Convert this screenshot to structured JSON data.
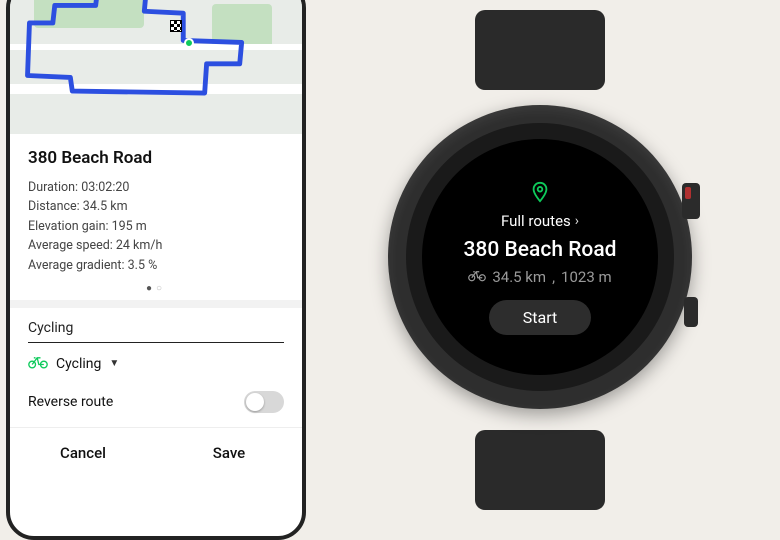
{
  "phone": {
    "route_title": "380 Beach Road",
    "stats": {
      "duration_label": "Duration:",
      "duration_value": "03:02:20",
      "distance_label": "Distance:",
      "distance_value": "34.5 km",
      "elev_label": "Elevation gain:",
      "elev_value": "195 m",
      "speed_label": "Average speed:",
      "speed_value": "24 km/h",
      "grad_label": "Average gradient:",
      "grad_value": "3.5 %"
    },
    "activity_section_label": "Cycling",
    "activity_selected": "Cycling",
    "reverse_label": "Reverse route",
    "reverse_on": false,
    "cancel_label": "Cancel",
    "save_label": "Save"
  },
  "watch": {
    "full_routes_label": "Full routes",
    "route_title": "380 Beach Road",
    "distance": "34.5 km",
    "elevation": "1023 m",
    "start_label": "Start"
  }
}
